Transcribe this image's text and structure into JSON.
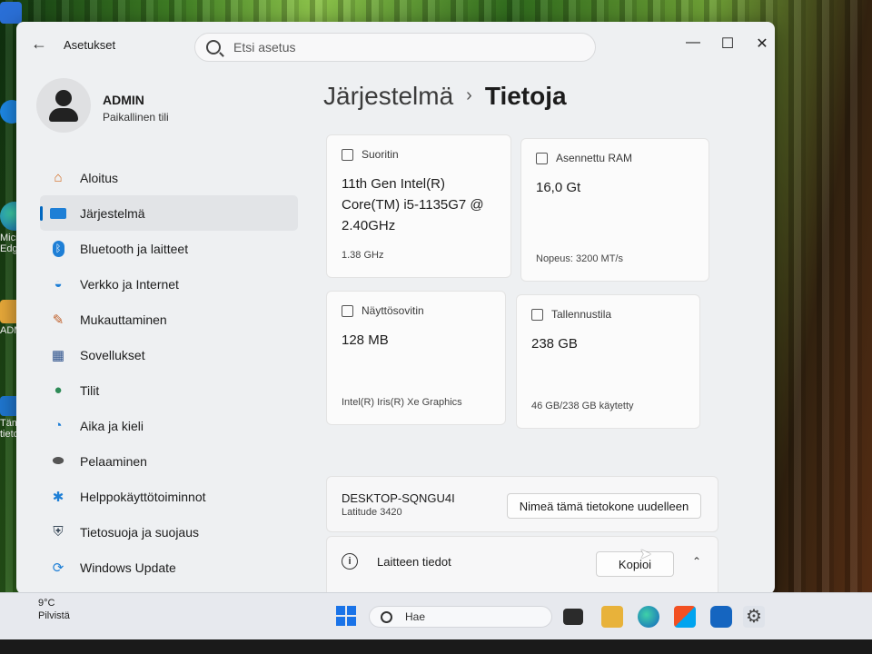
{
  "desktop": {
    "icons": [
      {
        "label": "Microsoft Edge",
        "short": "Micros\nEdge"
      },
      {
        "label": "ADMIN",
        "short": "ADM"
      },
      {
        "label": "Tämä tietokone",
        "short": "Täm\ntietoko"
      }
    ]
  },
  "window": {
    "app_title": "Asetukset",
    "search_placeholder": "Etsi asetus",
    "controls": {
      "minimize": "—",
      "maximize": "☐",
      "close": "✕"
    }
  },
  "profile": {
    "name": "ADMIN",
    "account_type": "Paikallinen tili"
  },
  "sidebar": {
    "items": [
      {
        "label": "Aloitus",
        "icon": "home-icon",
        "active": false
      },
      {
        "label": "Järjestelmä",
        "icon": "monitor-icon",
        "active": true
      },
      {
        "label": "Bluetooth ja laitteet",
        "icon": "bluetooth-icon",
        "active": false
      },
      {
        "label": "Verkko ja Internet",
        "icon": "wifi-icon",
        "active": false
      },
      {
        "label": "Mukauttaminen",
        "icon": "brush-icon",
        "active": false
      },
      {
        "label": "Sovellukset",
        "icon": "apps-icon",
        "active": false
      },
      {
        "label": "Tilit",
        "icon": "person-icon",
        "active": false
      },
      {
        "label": "Aika ja kieli",
        "icon": "globe-clock-icon",
        "active": false
      },
      {
        "label": "Pelaaminen",
        "icon": "gamepad-icon",
        "active": false
      },
      {
        "label": "Helppokäyttötoiminnot",
        "icon": "accessibility-icon",
        "active": false
      },
      {
        "label": "Tietosuoja ja suojaus",
        "icon": "shield-icon",
        "active": false
      },
      {
        "label": "Windows Update",
        "icon": "update-icon",
        "active": false
      }
    ]
  },
  "breadcrumb": {
    "parent": "Järjestelmä",
    "separator": "›",
    "current": "Tietoja"
  },
  "specs": {
    "processor": {
      "label": "Suoritin",
      "value": "11th Gen Intel(R) Core(TM) i5-1135G7 @ 2.40GHz",
      "detail": "1.38 GHz"
    },
    "ram": {
      "label": "Asennettu RAM",
      "value": "16,0 Gt",
      "detail": "Nopeus: 3200 MT/s"
    },
    "gpu": {
      "label": "Näyttösovitin",
      "value": "128 MB",
      "detail": "Intel(R) Iris(R) Xe Graphics"
    },
    "storage": {
      "label": "Tallennustila",
      "value": "238 GB",
      "detail": "46 GB/238 GB käytetty"
    }
  },
  "device": {
    "name": "DESKTOP-SQNGU4I",
    "model": "Latitude 3420",
    "rename_label": "Nimeä tämä tietokone uudelleen"
  },
  "device_info": {
    "label": "Laitteen tiedot",
    "copy_label": "Kopioi",
    "chevron": "⌃"
  },
  "taskbar": {
    "temperature": "9°C",
    "condition": "Pilvistä",
    "search_label": "Hae",
    "colors": {
      "accent": "#0067c0",
      "start": "#1a73e8"
    }
  }
}
